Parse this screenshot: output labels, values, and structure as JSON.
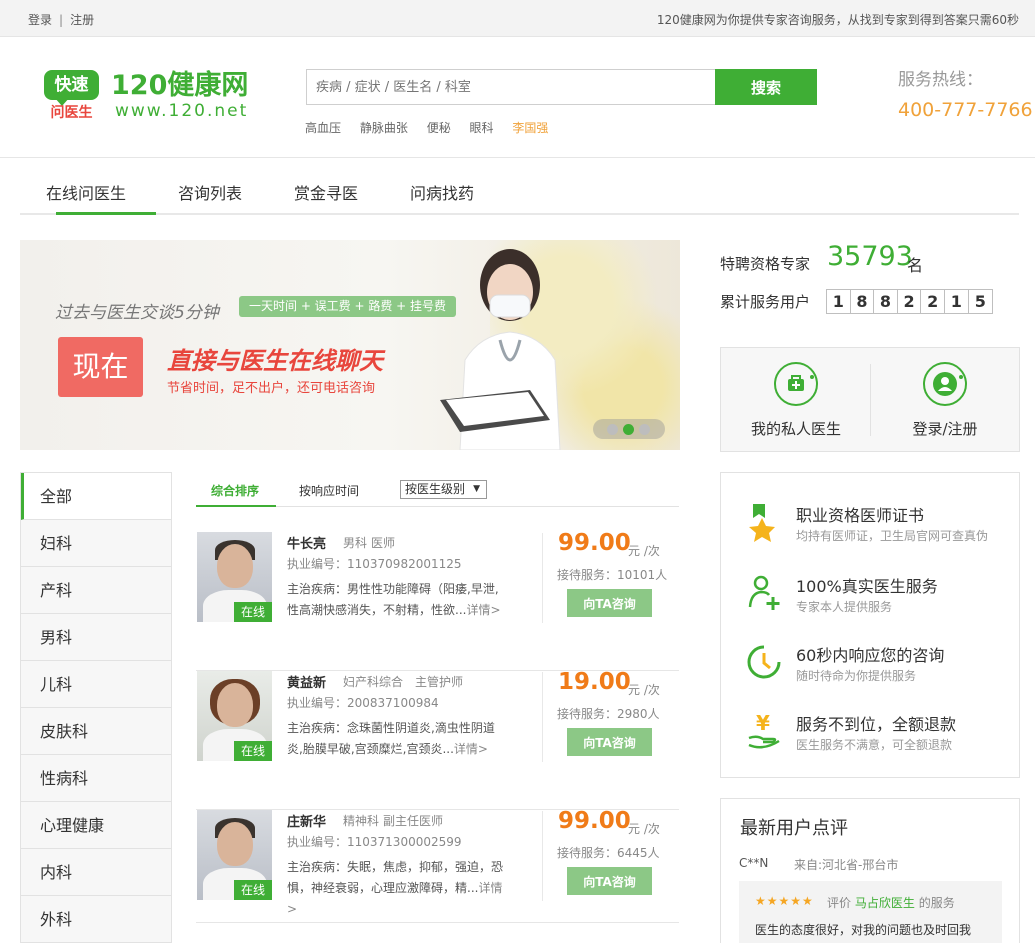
{
  "topbar": {
    "login": "登录",
    "sep": "|",
    "register": "注册",
    "notice": "120健康网为你提供专家咨询服务，从找到专家到得到答案只需60秒"
  },
  "logo": {
    "badge_top": "快速",
    "badge_bottom": "问医生",
    "title": "120健康网",
    "url": "www.120.net"
  },
  "search": {
    "placeholder": "疾病 / 症状 / 医生名 / 科室",
    "button": "搜索",
    "hot_tags": [
      "高血压",
      "静脉曲张",
      "便秘",
      "眼科",
      "李国强"
    ]
  },
  "hotline": {
    "label": "服务热线：",
    "number": "400-777-7766"
  },
  "nav": {
    "items": [
      "在线问医生",
      "咨询列表",
      "赏金寻医",
      "问病找药"
    ]
  },
  "banner": {
    "line1": "过去与医生交谈5分钟",
    "pill": "一天时间 + 误工费 + 路费 + 挂号费",
    "now": "现在",
    "headline": "直接与医生在线聊天",
    "subline": "节省时间，足不出户，还可电话咨询"
  },
  "stats": {
    "expert_label": "特聘资格专家",
    "expert_count": "35793",
    "expert_unit": "名",
    "served_label": "累计服务用户",
    "served_digits": [
      "1",
      "8",
      "8",
      "2",
      "2",
      "1",
      "5"
    ]
  },
  "userbox": {
    "private_doctor": "我的私人医生",
    "login_register": "登录/注册"
  },
  "filters": {
    "sort_comprehensive": "综合排序",
    "sort_response": "按响应时间",
    "level_select": "按医生级别",
    "level_arrow": "▼"
  },
  "categories": [
    "全部",
    "妇科",
    "产科",
    "男科",
    "儿科",
    "皮肤科",
    "性病科",
    "心理健康",
    "内科",
    "外科"
  ],
  "doctors": [
    {
      "name": "牛长亮",
      "dept": "男科",
      "title": "医师",
      "license": "执业编号：110370982001125",
      "desc": "主治疾病：男性性功能障碍（阳痿,早泄,性高潮快感消失，不射精，性欲...",
      "more": "详情>",
      "price": "99.00",
      "unit": "元 /次",
      "served": "接待服务：10101人",
      "online": "在线",
      "ask": "向TA咨询"
    },
    {
      "name": "黄益新",
      "dept": "妇产科综合",
      "title": "主管护师",
      "license": "执业编号：200837100984",
      "desc": "主治疾病：念珠菌性阴道炎,滴虫性阴道炎,胎膜早破,宫颈糜烂,宫颈炎...",
      "more": "详情>",
      "price": "19.00",
      "unit": "元 /次",
      "served": "接待服务：2980人",
      "online": "在线",
      "ask": "向TA咨询"
    },
    {
      "name": "庄新华",
      "dept": "精神科",
      "title": "副主任医师",
      "license": "执业编号：110371300002599",
      "desc": "主治疾病：失眠，焦虑，抑郁，强迫，恐惧，神经衰弱，心理应激障碍，精...",
      "more": "详情>",
      "price": "99.00",
      "unit": "元 /次",
      "served": "接待服务：6445人",
      "online": "在线",
      "ask": "向TA咨询"
    }
  ],
  "services": [
    {
      "title": "职业资格医师证书",
      "sub": "均持有医师证，卫生局官网可查真伪",
      "icon": "certificate-star-icon"
    },
    {
      "title": "100%真实医生服务",
      "sub": "专家本人提供服务",
      "icon": "user-plus-icon"
    },
    {
      "title": "60秒内响应您的咨询",
      "sub": "随时待命为你提供服务",
      "icon": "clock-icon"
    },
    {
      "title": "服务不到位，全额退款",
      "sub": "医生服务不满意，可全额退款",
      "icon": "yen-refund-icon"
    }
  ],
  "reviews": {
    "title": "最新用户点评",
    "user": "C**N",
    "from": "来自:河北省-邢台市",
    "stars": "★★★★★",
    "rate_prefix": "评价",
    "doctor": "马占欣医生",
    "rate_suffix": "的服务",
    "text": "医生的态度很好，对我的问题也及时回我"
  },
  "colors": {
    "brand_green": "#3fae35",
    "price_orange": "#f07b18",
    "hotline_orange": "#f0a23a",
    "banner_red": "#e8463d"
  }
}
